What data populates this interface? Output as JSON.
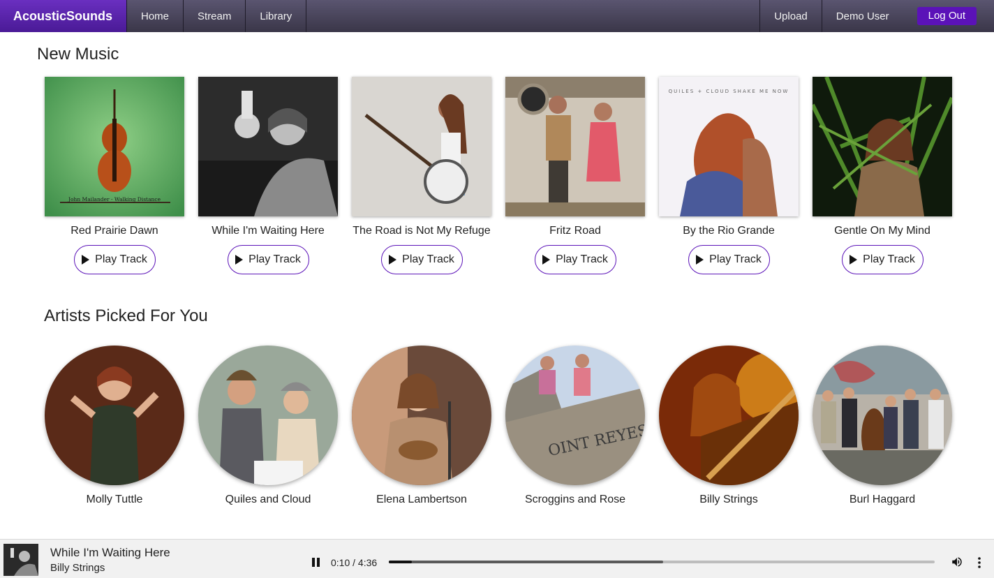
{
  "nav": {
    "brand": "AcousticSounds",
    "links": [
      {
        "label": "Home"
      },
      {
        "label": "Stream"
      },
      {
        "label": "Library"
      }
    ],
    "upload": "Upload",
    "user": "Demo User",
    "logout": "Log Out"
  },
  "colors": {
    "brand_purple": "#5b12b8",
    "nav_bg": "#3a3648"
  },
  "new_music": {
    "title": "New Music",
    "play_label": "Play Track",
    "tracks": [
      {
        "title": "Red Prairie Dawn",
        "cover_text": "John Mailander - Walking Distance"
      },
      {
        "title": "While I'm Waiting Here"
      },
      {
        "title": "The Road is Not My Refuge"
      },
      {
        "title": "Fritz Road"
      },
      {
        "title": "By the Rio Grande",
        "cover_text": "QUILES + CLOUD   SHAKE ME NOW"
      },
      {
        "title": "Gentle On My Mind"
      }
    ]
  },
  "artists": {
    "title": "Artists Picked For You",
    "items": [
      {
        "name": "Molly Tuttle"
      },
      {
        "name": "Quiles and Cloud"
      },
      {
        "name": "Elena Lambertson"
      },
      {
        "name": "Scroggins and Rose"
      },
      {
        "name": "Billy Strings"
      },
      {
        "name": "Burl Haggard"
      }
    ]
  },
  "player": {
    "title": "While I'm Waiting Here",
    "artist": "Billy Strings",
    "time": "0:10 / 4:36",
    "played_fraction": 0.042,
    "buffered_fraction": 0.503,
    "icons": {
      "pause": "pause-icon",
      "volume": "volume-icon",
      "more": "more-vert-icon"
    }
  }
}
